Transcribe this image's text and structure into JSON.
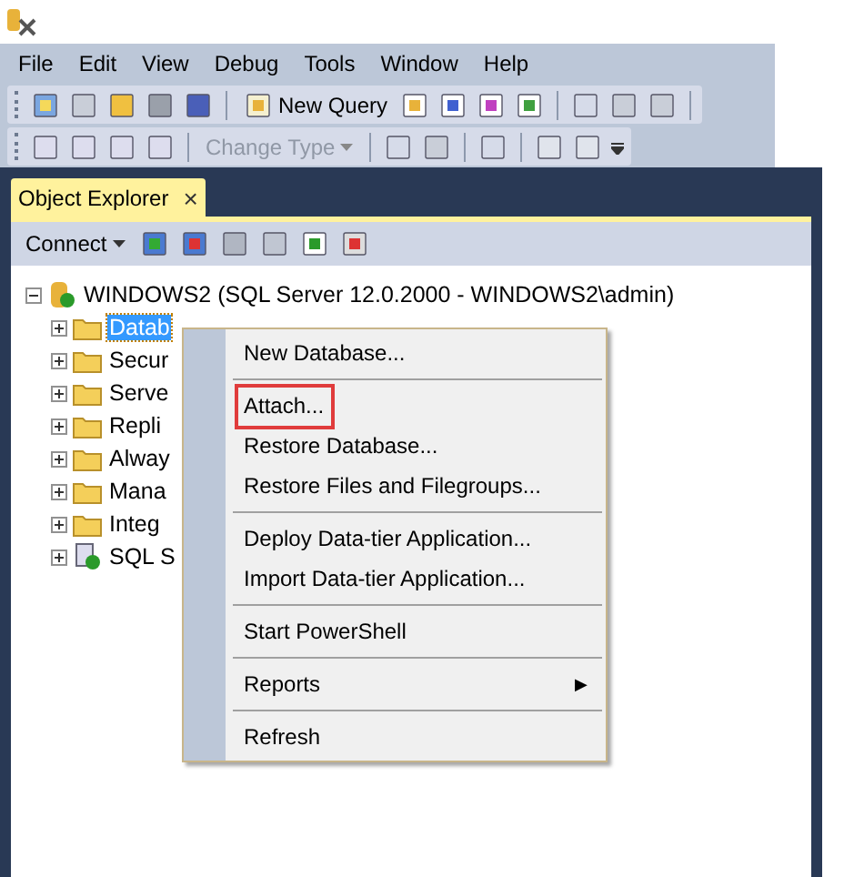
{
  "menu_bar": [
    "File",
    "Edit",
    "View",
    "Debug",
    "Tools",
    "Window",
    "Help"
  ],
  "toolbar": {
    "new_query": "New Query",
    "change_type": {
      "label": "Change Type",
      "disabled": true
    }
  },
  "panel": {
    "tab": {
      "label": "Object Explorer",
      "close": "×",
      "selected": true
    },
    "connect": "Connect",
    "tree": {
      "label": "WINDOWS2 (SQL Server 12.0.2000 - WINDOWS2\\admin)",
      "expanded": true,
      "children": [
        {
          "label": "Datab",
          "kind": "folder",
          "selected": true
        },
        {
          "label": "Secur",
          "kind": "folder",
          "selected": false
        },
        {
          "label": "Serve",
          "kind": "folder",
          "selected": false
        },
        {
          "label": "Repli",
          "kind": "folder",
          "selected": false
        },
        {
          "label": "Alway",
          "kind": "folder",
          "selected": false
        },
        {
          "label": "Mana",
          "kind": "folder",
          "selected": false
        },
        {
          "label": "Integ",
          "kind": "folder",
          "selected": false
        },
        {
          "label": "SQL S",
          "kind": "agent",
          "selected": false
        }
      ]
    }
  },
  "context_menu": [
    {
      "kind": "item",
      "label": "New Database...",
      "highlighted": false
    },
    {
      "kind": "separator"
    },
    {
      "kind": "item",
      "label": "Attach...",
      "highlighted": true
    },
    {
      "kind": "item",
      "label": "Restore Database...",
      "highlighted": false
    },
    {
      "kind": "item",
      "label": "Restore Files and Filegroups...",
      "highlighted": false
    },
    {
      "kind": "separator"
    },
    {
      "kind": "item",
      "label": "Deploy Data-tier Application...",
      "highlighted": false
    },
    {
      "kind": "item",
      "label": "Import Data-tier Application...",
      "highlighted": false
    },
    {
      "kind": "separator"
    },
    {
      "kind": "item",
      "label": "Start PowerShell",
      "highlighted": false
    },
    {
      "kind": "separator"
    },
    {
      "kind": "submenu",
      "label": "Reports",
      "arrow": "▶",
      "highlighted": false
    },
    {
      "kind": "separator"
    },
    {
      "kind": "item",
      "label": "Refresh",
      "highlighted": false
    }
  ]
}
